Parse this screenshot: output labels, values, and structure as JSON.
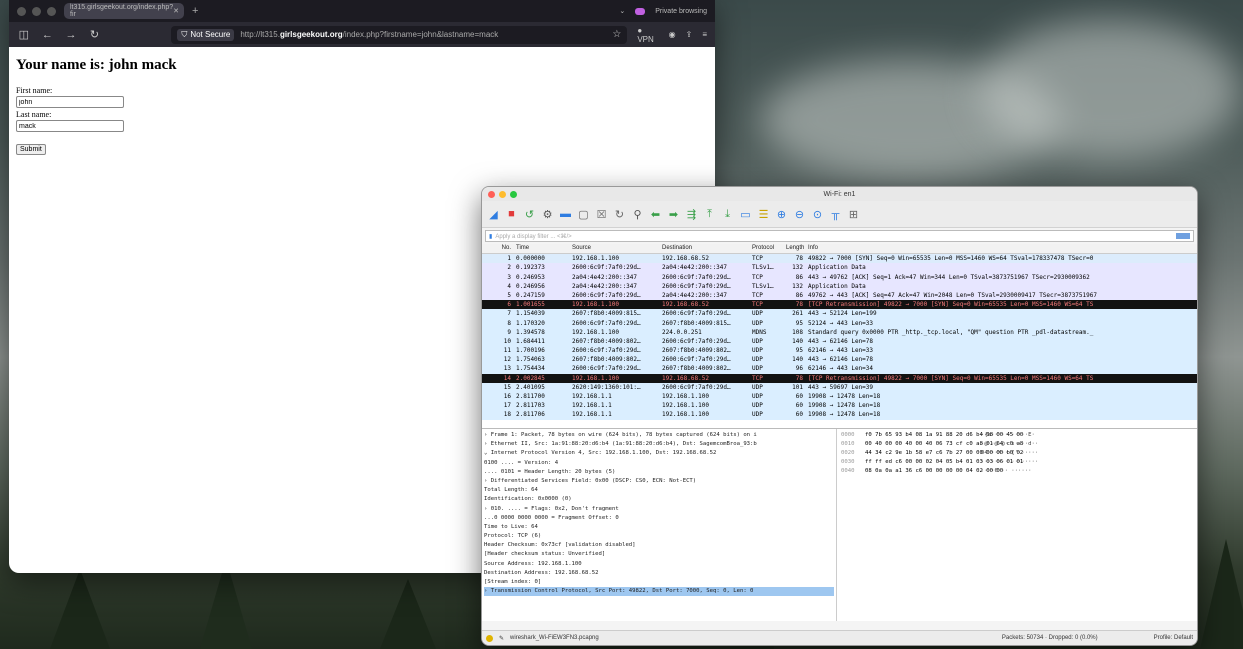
{
  "browser": {
    "tab_title": "lt315.girlsgeekout.org/index.php?fir",
    "tab_close": "✕",
    "new_tab": "+",
    "private_label": "Private browsing",
    "not_secure": "Not Secure",
    "url_prefix": "http://lt315.",
    "url_domain": "girlsgeekout.org",
    "url_path": "/index.php?firstname=john&lastname=mack",
    "vpn_label": "VPN"
  },
  "page": {
    "heading": "Your name is: john mack",
    "first_label": "First name:",
    "first_value": "john",
    "last_label": "Last name:",
    "last_value": "mack",
    "submit_label": "Submit"
  },
  "wireshark": {
    "title": "Wi-Fi: en1",
    "filter_placeholder": "Apply a display filter ... <⌘/>",
    "columns": [
      "No.",
      "Time",
      "Source",
      "Destination",
      "Protocol",
      "Length",
      "Info"
    ],
    "packets": [
      {
        "no": "1",
        "time": "0.000000",
        "src": "192.168.1.100",
        "dst": "192.168.68.52",
        "proto": "TCP",
        "len": "78",
        "info": "49822 → 7000 [SYN] Seq=0 Win=65535 Len=0 MSS=1460 WS=64 TSval=178337478 TSecr=0",
        "style": "r-selected"
      },
      {
        "no": "2",
        "time": "0.192373",
        "src": "2600:6c9f:7af0:29d…",
        "dst": "2a04:4e42:200::347",
        "proto": "TLSv1…",
        "len": "132",
        "info": "Application Data",
        "style": "r-blue"
      },
      {
        "no": "3",
        "time": "0.246953",
        "src": "2a04:4e42:200::347",
        "dst": "2600:6c9f:7af0:29d…",
        "proto": "TCP",
        "len": "86",
        "info": "443 → 49762 [ACK] Seq=1 Ack=47 Win=344 Len=0 TSval=3873751967 TSecr=2930009362",
        "style": "r-blue"
      },
      {
        "no": "4",
        "time": "0.246956",
        "src": "2a04:4e42:200::347",
        "dst": "2600:6c9f:7af0:29d…",
        "proto": "TLSv1…",
        "len": "132",
        "info": "Application Data",
        "style": "r-blue"
      },
      {
        "no": "5",
        "time": "0.247159",
        "src": "2600:6c9f:7af0:29d…",
        "dst": "2a04:4e42:200::347",
        "proto": "TCP",
        "len": "86",
        "info": "49762 → 443 [ACK] Seq=47 Ack=47 Win=2048 Len=0 TSval=2930009417 TSecr=3873751967",
        "style": "r-blue"
      },
      {
        "no": "6",
        "time": "1.001655",
        "src": "192.168.1.100",
        "dst": "192.168.68.52",
        "proto": "TCP",
        "len": "78",
        "info": "[TCP Retransmission] 49822 → 7000 [SYN] Seq=0 Win=65535 Len=0 MSS=1460 WS=64 TS",
        "style": "r-black"
      },
      {
        "no": "7",
        "time": "1.154039",
        "src": "2607:f8b0:4009:815…",
        "dst": "2600:6c9f:7af0:29d…",
        "proto": "UDP",
        "len": "261",
        "info": "443 → 52124 Len=199",
        "style": "r-cyan"
      },
      {
        "no": "8",
        "time": "1.170320",
        "src": "2600:6c9f:7af0:29d…",
        "dst": "2607:f8b0:4009:815…",
        "proto": "UDP",
        "len": "95",
        "info": "52124 → 443 Len=33",
        "style": "r-cyan"
      },
      {
        "no": "9",
        "time": "1.394578",
        "src": "192.168.1.100",
        "dst": "224.0.0.251",
        "proto": "MDNS",
        "len": "108",
        "info": "Standard query 0x0000 PTR _http._tcp.local, \"QM\" question PTR _pdl-datastream._",
        "style": "r-cyan"
      },
      {
        "no": "10",
        "time": "1.684411",
        "src": "2607:f8b0:4009:802…",
        "dst": "2600:6c9f:7af0:29d…",
        "proto": "UDP",
        "len": "140",
        "info": "443 → 62146 Len=78",
        "style": "r-cyan"
      },
      {
        "no": "11",
        "time": "1.700196",
        "src": "2600:6c9f:7af0:29d…",
        "dst": "2607:f8b0:4009:802…",
        "proto": "UDP",
        "len": "95",
        "info": "62146 → 443 Len=33",
        "style": "r-cyan"
      },
      {
        "no": "12",
        "time": "1.754063",
        "src": "2607:f8b0:4009:802…",
        "dst": "2600:6c9f:7af0:29d…",
        "proto": "UDP",
        "len": "140",
        "info": "443 → 62146 Len=78",
        "style": "r-cyan"
      },
      {
        "no": "13",
        "time": "1.754434",
        "src": "2600:6c9f:7af0:29d…",
        "dst": "2607:f8b0:4009:802…",
        "proto": "UDP",
        "len": "96",
        "info": "62146 → 443 Len=34",
        "style": "r-cyan"
      },
      {
        "no": "14",
        "time": "2.002845",
        "src": "192.168.1.100",
        "dst": "192.168.68.52",
        "proto": "TCP",
        "len": "78",
        "info": "[TCP Retransmission] 49822 → 7000 [SYN] Seq=0 Win=65535 Len=0 MSS=1460 WS=64 TS",
        "style": "r-black"
      },
      {
        "no": "15",
        "time": "2.401095",
        "src": "2620:149:1360:101:…",
        "dst": "2600:6c9f:7af0:29d…",
        "proto": "UDP",
        "len": "101",
        "info": "443 → 59697 Len=39",
        "style": "r-cyan"
      },
      {
        "no": "16",
        "time": "2.811700",
        "src": "192.168.1.1",
        "dst": "192.168.1.100",
        "proto": "UDP",
        "len": "60",
        "info": "19908 → 12478 Len=18",
        "style": "r-cyan"
      },
      {
        "no": "17",
        "time": "2.811703",
        "src": "192.168.1.1",
        "dst": "192.168.1.100",
        "proto": "UDP",
        "len": "60",
        "info": "19908 → 12478 Len=18",
        "style": "r-cyan"
      },
      {
        "no": "18",
        "time": "2.811706",
        "src": "192.168.1.1",
        "dst": "192.168.1.100",
        "proto": "UDP",
        "len": "60",
        "info": "19908 → 12478 Len=18",
        "style": "r-cyan"
      }
    ],
    "details": [
      {
        "text": "› Frame 1: Packet, 78 bytes on wire (624 bits), 78 bytes captured (624 bits) on i",
        "selected": false
      },
      {
        "text": "› Ethernet II, Src: 1a:91:88:20:d6:b4 (1a:91:88:20:d6:b4), Dst: SagemcomBroa_93:b",
        "selected": false
      },
      {
        "text": "⌄ Internet Protocol Version 4, Src: 192.168.1.100, Dst: 192.168.68.52",
        "selected": false
      },
      {
        "text": "    0100 .... = Version: 4",
        "selected": false
      },
      {
        "text": "    .... 0101 = Header Length: 20 bytes (5)",
        "selected": false
      },
      {
        "text": "  › Differentiated Services Field: 0x00 (DSCP: CS0, ECN: Not-ECT)",
        "selected": false
      },
      {
        "text": "    Total Length: 64",
        "selected": false
      },
      {
        "text": "    Identification: 0x0000 (0)",
        "selected": false
      },
      {
        "text": "  › 010. .... = Flags: 0x2, Don't fragment",
        "selected": false
      },
      {
        "text": "    ...0 0000 0000 0000 = Fragment Offset: 0",
        "selected": false
      },
      {
        "text": "    Time to Live: 64",
        "selected": false
      },
      {
        "text": "    Protocol: TCP (6)",
        "selected": false
      },
      {
        "text": "    Header Checksum: 0x73cf [validation disabled]",
        "selected": false
      },
      {
        "text": "    [Header checksum status: Unverified]",
        "selected": false
      },
      {
        "text": "    Source Address: 192.168.1.100",
        "selected": false
      },
      {
        "text": "    Destination Address: 192.168.68.52",
        "selected": false
      },
      {
        "text": "    [Stream index: 0]",
        "selected": false
      },
      {
        "text": "› Transmission Control Protocol, Src Port: 49822, Dst Port: 7000, Seq: 0, Len: 0",
        "selected": true
      }
    ],
    "hex": [
      {
        "off": "0000",
        "bytes": "f0 7b 65 93 b4 08 1a 91  88 20 d6 b4 08 00 45 00",
        "ascii": "·{e····· ·····E·"
      },
      {
        "off": "0010",
        "bytes": "00 40 00 00 40 00 40 06  73 cf c0 a8 01 64 c0 a8",
        "ascii": "·@··@·@· s····d··"
      },
      {
        "off": "0020",
        "bytes": "44 34 c2 9e 1b 58 e7 c6  7b 27 00 00 00 00 b0 02",
        "ascii": "D4···X·· {'······"
      },
      {
        "off": "0030",
        "bytes": "ff ff ed c6 00 00 02 04  05 b4 01 03 03 06 01 01",
        "ascii": "········ ········"
      },
      {
        "off": "0040",
        "bytes": "08 0a 0a a1 36 c6 00 00  00 00 04 02 00 00",
        "ascii": "····6··· ······"
      }
    ],
    "status_file": "wireshark_Wi-FiEW3FN3.pcapng",
    "status_packets": "Packets: 50734 · Dropped: 0 (0.0%)",
    "status_profile": "Profile: Default"
  },
  "colors": {
    "browser_chrome": "#2b2a33",
    "tab_bg": "#1c1b22",
    "retrans_row": "#121212",
    "retrans_text": "#f77a7a",
    "udp_row": "#daeeff",
    "tcp_row": "#e7e6ff"
  }
}
